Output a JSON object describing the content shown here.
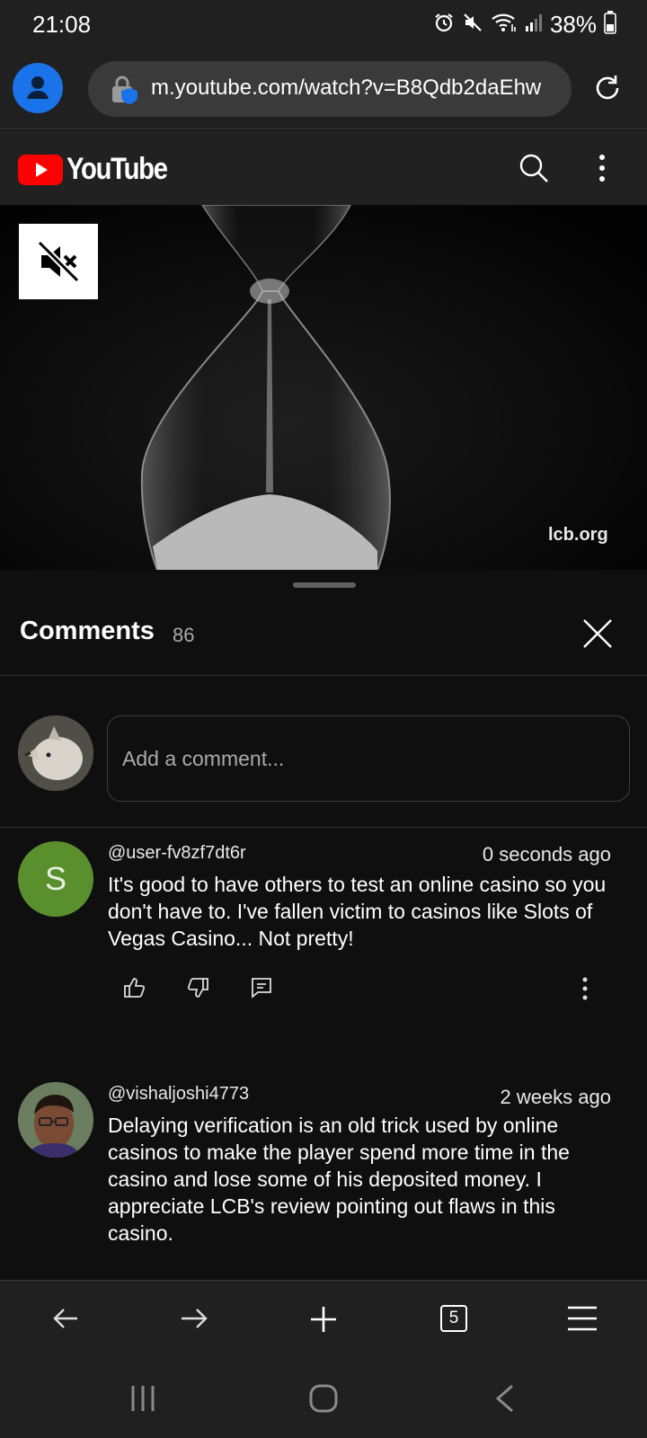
{
  "status_bar": {
    "time": "21:08",
    "battery_percent": "38%",
    "icons": [
      "alarm-icon",
      "mute-icon",
      "wifi-icon",
      "signal-icon",
      "battery-icon"
    ]
  },
  "browser": {
    "url": "m.youtube.com/watch?v=B8Qdb2daEhw",
    "tab_count": "5"
  },
  "youtube": {
    "logo_text": "YouTube",
    "brand_color": "#ff0000"
  },
  "video": {
    "watermark": "lcb.org"
  },
  "comments": {
    "title": "Comments",
    "count": "86",
    "input_placeholder": "Add a comment...",
    "items": [
      {
        "author": "@user-fv8zf7dt6r",
        "time": "0 seconds ago",
        "avatar_letter": "S",
        "avatar_color": "#5a8f2e",
        "text": "It's good to have others to test an online casino so you don't have to. I've fallen victim to casinos like Slots of Vegas Casino... Not pretty!"
      },
      {
        "author": "@vishaljoshi4773",
        "time": "2 weeks ago",
        "text": "Delaying verification is an old trick used by online casinos to make the player spend more time in the casino and lose some of his deposited money. I appreciate LCB's review pointing out flaws in this casino."
      }
    ]
  }
}
